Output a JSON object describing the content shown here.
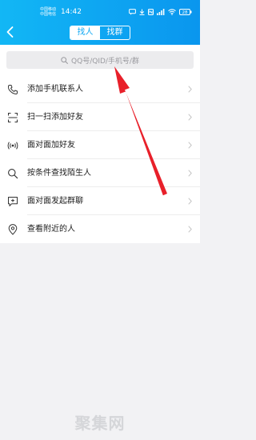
{
  "status_bar": {
    "carrier_1": "中国移动",
    "carrier_2": "中国电信",
    "time": "14:42",
    "battery": "28",
    "icons": [
      "message-icon",
      "download-icon",
      "nfc-icon",
      "signal-icon",
      "wifi-icon",
      "battery-icon"
    ]
  },
  "header": {
    "back_icon": "chevron-left-icon",
    "tabs": [
      {
        "label": "找人",
        "active": true
      },
      {
        "label": "找群",
        "active": false
      }
    ]
  },
  "search": {
    "placeholder": "QQ号/QID/手机号/群",
    "icon": "search-icon"
  },
  "menu": {
    "items": [
      {
        "label": "添加手机联系人",
        "icon": "phone-icon"
      },
      {
        "label": "扫一扫添加好友",
        "icon": "scan-icon"
      },
      {
        "label": "面对面加好友",
        "icon": "broadcast-icon"
      },
      {
        "label": "按条件查找陌生人",
        "icon": "search-icon"
      },
      {
        "label": "面对面发起群聊",
        "icon": "chat-add-icon"
      },
      {
        "label": "查看附近的人",
        "icon": "location-pin-icon"
      }
    ]
  },
  "watermark": "聚集网",
  "colors": {
    "header": "#12b7f5",
    "annotation_arrow": "#e8202a",
    "background": "#f2f2f4"
  }
}
